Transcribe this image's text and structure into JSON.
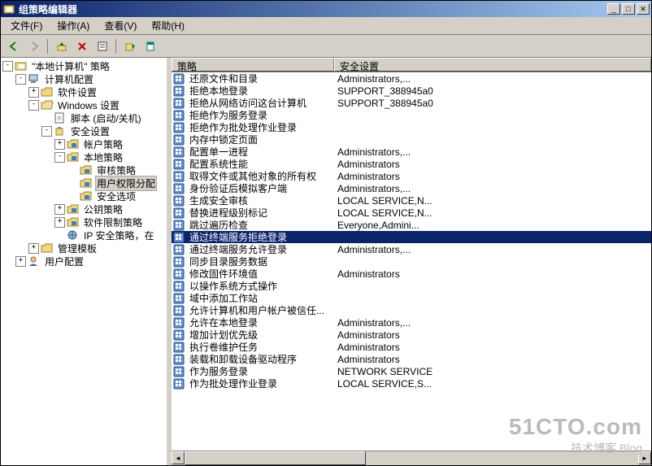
{
  "window": {
    "title": "组策略编辑器"
  },
  "menubar": [
    "文件(F)",
    "操作(A)",
    "查看(V)",
    "帮助(H)"
  ],
  "list_header": {
    "col1": "策略",
    "col2": "安全设置"
  },
  "tree": [
    {
      "level": 0,
      "exp": "-",
      "icon": "root",
      "label": "\"本地计算机\" 策略",
      "sel": false
    },
    {
      "level": 1,
      "exp": "-",
      "icon": "computer",
      "label": "计算机配置",
      "sel": false
    },
    {
      "level": 2,
      "exp": "+",
      "icon": "folder-closed",
      "label": "软件设置",
      "sel": false
    },
    {
      "level": 2,
      "exp": "-",
      "icon": "folder-open",
      "label": "Windows 设置",
      "sel": false
    },
    {
      "level": 3,
      "exp": "",
      "icon": "script",
      "label": "脚本 (启动/关机)",
      "sel": false
    },
    {
      "level": 3,
      "exp": "-",
      "icon": "security",
      "label": "安全设置",
      "sel": false
    },
    {
      "level": 4,
      "exp": "+",
      "icon": "policy-folder",
      "label": "帐户策略",
      "sel": false
    },
    {
      "level": 4,
      "exp": "-",
      "icon": "policy-folder",
      "label": "本地策略",
      "sel": false
    },
    {
      "level": 5,
      "exp": "",
      "icon": "policy-folder",
      "label": "审核策略",
      "sel": false
    },
    {
      "level": 5,
      "exp": "",
      "icon": "policy-folder",
      "label": "用户权限分配",
      "sel": true
    },
    {
      "level": 5,
      "exp": "",
      "icon": "policy-folder",
      "label": "安全选项",
      "sel": false
    },
    {
      "level": 4,
      "exp": "+",
      "icon": "policy-folder",
      "label": "公钥策略",
      "sel": false
    },
    {
      "level": 4,
      "exp": "+",
      "icon": "policy-folder",
      "label": "软件限制策略",
      "sel": false
    },
    {
      "level": 4,
      "exp": "",
      "icon": "ipsec",
      "label": "IP 安全策略，在",
      "sel": false
    },
    {
      "level": 2,
      "exp": "+",
      "icon": "folder-closed",
      "label": "管理模板",
      "sel": false
    },
    {
      "level": 1,
      "exp": "+",
      "icon": "user",
      "label": "用户配置",
      "sel": false
    }
  ],
  "rows": [
    {
      "policy": "还原文件和目录",
      "setting": "Administrators,...",
      "sel": false
    },
    {
      "policy": "拒绝本地登录",
      "setting": "SUPPORT_388945a0",
      "sel": false
    },
    {
      "policy": "拒绝从网络访问这台计算机",
      "setting": "SUPPORT_388945a0",
      "sel": false
    },
    {
      "policy": "拒绝作为服务登录",
      "setting": "",
      "sel": false
    },
    {
      "policy": "拒绝作为批处理作业登录",
      "setting": "",
      "sel": false
    },
    {
      "policy": "内存中锁定页面",
      "setting": "",
      "sel": false
    },
    {
      "policy": "配置单一进程",
      "setting": "Administrators,...",
      "sel": false
    },
    {
      "policy": "配置系统性能",
      "setting": "Administrators",
      "sel": false
    },
    {
      "policy": "取得文件或其他对象的所有权",
      "setting": "Administrators",
      "sel": false
    },
    {
      "policy": "身份验证后模拟客户端",
      "setting": "Administrators,...",
      "sel": false
    },
    {
      "policy": "生成安全审核",
      "setting": "LOCAL SERVICE,N...",
      "sel": false
    },
    {
      "policy": "替换进程级别标记",
      "setting": "LOCAL SERVICE,N...",
      "sel": false
    },
    {
      "policy": "跳过遍历检查",
      "setting": "Everyone,Admini...",
      "sel": false
    },
    {
      "policy": "通过终端服务拒绝登录",
      "setting": "",
      "sel": true
    },
    {
      "policy": "通过终端服务允许登录",
      "setting": "Administrators,...",
      "sel": false
    },
    {
      "policy": "同步目录服务数据",
      "setting": "",
      "sel": false
    },
    {
      "policy": "修改固件环境值",
      "setting": "Administrators",
      "sel": false
    },
    {
      "policy": "以操作系统方式操作",
      "setting": "",
      "sel": false
    },
    {
      "policy": "域中添加工作站",
      "setting": "",
      "sel": false
    },
    {
      "policy": "允许计算机和用户帐户被信任...",
      "setting": "",
      "sel": false
    },
    {
      "policy": "允许在本地登录",
      "setting": "Administrators,...",
      "sel": false
    },
    {
      "policy": "增加计划优先级",
      "setting": "Administrators",
      "sel": false
    },
    {
      "policy": "执行卷维护任务",
      "setting": "Administrators",
      "sel": false
    },
    {
      "policy": "装载和卸载设备驱动程序",
      "setting": "Administrators",
      "sel": false
    },
    {
      "policy": "作为服务登录",
      "setting": "NETWORK SERVICE",
      "sel": false
    },
    {
      "policy": "作为批处理作业登录",
      "setting": "LOCAL SERVICE,S...",
      "sel": false
    }
  ],
  "watermark": {
    "big": "51CTO.com",
    "small": "技术博客   Blog"
  }
}
